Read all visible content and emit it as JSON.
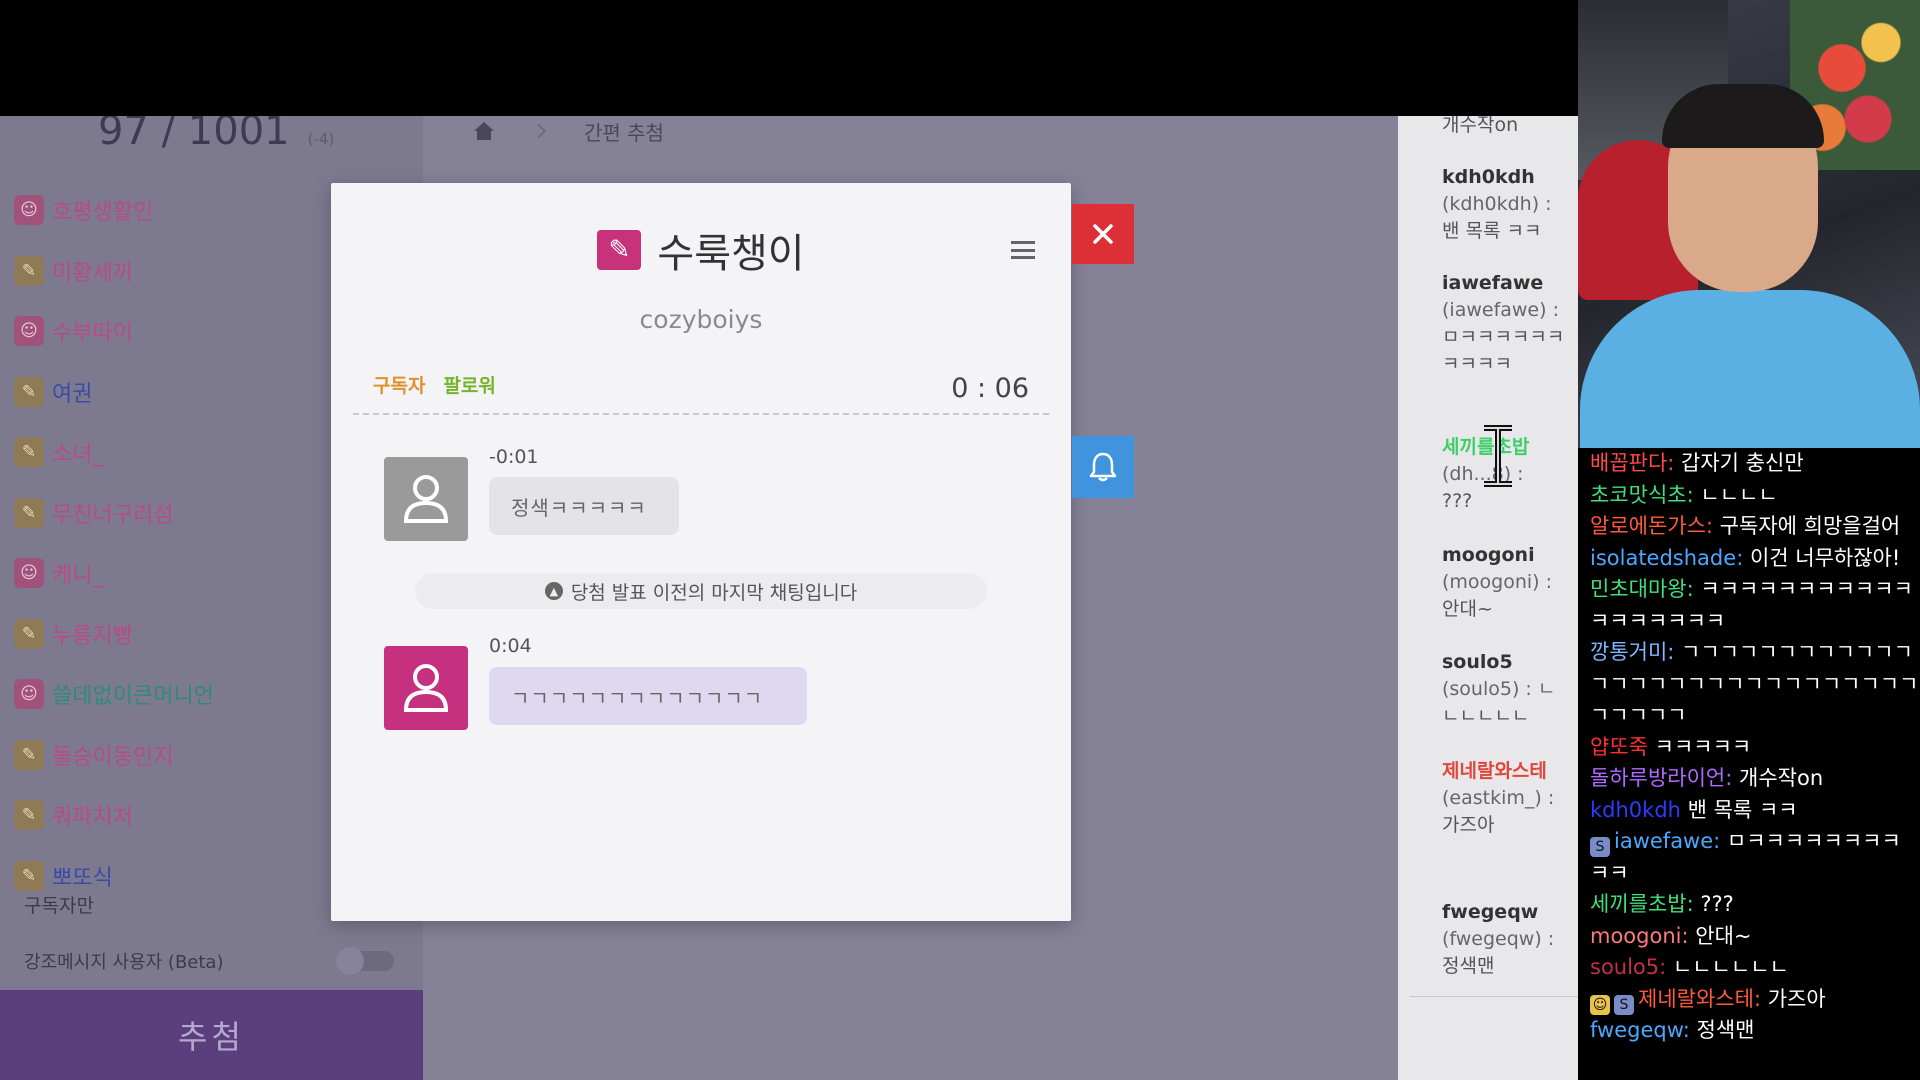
{
  "counter": {
    "count": "97 / 1001",
    "delta": "(-4)"
  },
  "winners": [
    {
      "name": "호평생활인",
      "icon": "subscriber-icon",
      "color": "#b84a8a"
    },
    {
      "name": "미황세끼",
      "icon": "fan-icon",
      "color": "#b84a8a"
    },
    {
      "name": "수부따이",
      "icon": "subscriber-icon",
      "color": "#b84a8a"
    },
    {
      "name": "여권",
      "icon": "fan-icon",
      "color": "#3a4aa8"
    },
    {
      "name": "소녀_",
      "icon": "fan-icon",
      "color": "#b84a8a"
    },
    {
      "name": "무친너구리섬",
      "icon": "fan-icon",
      "color": "#b84a8a"
    },
    {
      "name": "케니_",
      "icon": "subscriber-icon",
      "color": "#b84a8a"
    },
    {
      "name": "누룽지빵",
      "icon": "fan-icon",
      "color": "#b84a8a"
    },
    {
      "name": "쓸데없이큰머니언",
      "icon": "subscriber-icon",
      "color": "#2f8a7a"
    },
    {
      "name": "돌숭이동인지",
      "icon": "fan-icon",
      "color": "#b84a8a"
    },
    {
      "name": "쿼파치처",
      "icon": "fan-icon",
      "color": "#b84a8a"
    },
    {
      "name": "뽀또식",
      "icon": "fan-icon",
      "color": "#3a4aa8"
    }
  ],
  "sidebar": {
    "sub_only_label": "구독자만",
    "highlight_label": "강조메시지 사용자 (Beta)",
    "draw_button": "추첨"
  },
  "breadcrumb": {
    "current": "간편 추첨"
  },
  "modal": {
    "winner_name": "수룩챙이",
    "winner_id": "cozyboiys",
    "badge_subscriber": "구독자",
    "badge_follower": "팔로워",
    "timer": "0 : 06",
    "chat1": {
      "time": "-0:01",
      "message": "정색ㅋㅋㅋㅋㅋ"
    },
    "last_chat_note": "당첨 발표 이전의 마지막 채팅입니다",
    "chat2": {
      "time": "0:04",
      "message": "ㄱㄱㄱㄱㄱㄱㄱㄱㄱㄱㄱㄱㄱ"
    }
  },
  "chat_log": [
    {
      "name": "",
      "id": "",
      "message": "개수작on",
      "name_color": "#333"
    },
    {
      "name": "kdh0kdh",
      "id": "(kdh0kdh) :",
      "message": "밴 목록 ㅋㅋ",
      "name_color": "#333"
    },
    {
      "name": "iawefawe",
      "id": "(iawefawe) :",
      "message": "ㅁㅋㅋㅋㅋㅋㅋㅋㅋㅋㅋ",
      "name_color": "#333"
    },
    {
      "name": "세끼를초밥",
      "id": "(dh...8) :",
      "message": "???",
      "name_color": "#3fcf6a"
    },
    {
      "name": "moogoni",
      "id": "(moogoni) :",
      "message": "안대~",
      "name_color": "#333"
    },
    {
      "name": "soulo5",
      "id": "(soulo5) : ㄴ",
      "message": "ㄴㄴㄴㄴㄴ",
      "name_color": "#333"
    },
    {
      "name": "제네랄와스테",
      "id": "(eastkim_) :",
      "message": "가즈아",
      "name_color": "#e0463a"
    },
    {
      "name": "fwegeqw",
      "id": "(fwegeqw) :",
      "message": "정색맨",
      "name_color": "#333"
    }
  ],
  "stream_chat": [
    {
      "name": "배꼽판다",
      "sep": ": ",
      "message": "갑자기 충신만",
      "color": "#ff4a4a",
      "badges": []
    },
    {
      "name": "초코맛식초",
      "sep": ": ",
      "message": "ㄴㄴㄴㄴ",
      "color": "#3fe07a",
      "badges": []
    },
    {
      "name": "알로에돈가스",
      "sep": ": ",
      "message": "구독자에 희망을걸어",
      "color": "#ff5a3c",
      "badges": []
    },
    {
      "name": "isolatedshade",
      "sep": ": ",
      "message": "이건 너무하잖아!",
      "color": "#4aa8ff",
      "badges": []
    },
    {
      "name": "민초대마왕",
      "sep": ": ",
      "message": "ㅋㅋㅋㅋㅋㅋㅋㅋㅋㅋㅋㅋㅋㅋㅋㅋㅋㅋ",
      "color": "#3fe07a",
      "badges": []
    },
    {
      "name": "깡통거미",
      "sep": ": ",
      "message": "ㄱㄱㄱㄱㄱㄱㄱㄱㄱㄱㄱㄱㄱㄱㄱㄱㄱㄱㄱㄱㄱㄱㄱㄱㄱㄱㄱㄱㄱㄱㄱㄱㄱㄱ",
      "color": "#7fb8ff",
      "badges": []
    },
    {
      "name": "얍또죽",
      "sep": " ",
      "message": "ㅋㅋㅋㅋㅋ",
      "color": "#ff3030",
      "badges": []
    },
    {
      "name": "돌하루방라이언",
      "sep": ": ",
      "message": "개수작on",
      "color": "#b06aff",
      "badges": []
    },
    {
      "name": "kdh0kdh",
      "sep": " ",
      "message": "밴 목록 ㅋㅋ",
      "color": "#2a3dff",
      "badges": []
    },
    {
      "name": "iawefawe",
      "sep": ": ",
      "message": "ㅁㅋㅋㅋㅋㅋㅋㅋㅋㅋㅋ",
      "color": "#4aa8ff",
      "badges": [
        "S"
      ]
    },
    {
      "name": "세끼를초밥",
      "sep": ": ",
      "message": "???",
      "color": "#3fe07a",
      "badges": []
    },
    {
      "name": "moogoni",
      "sep": ": ",
      "message": "안대~",
      "color": "#ff7a7a",
      "badges": []
    },
    {
      "name": "soulo5",
      "sep": ": ",
      "message": "ㄴㄴㄴㄴㄴㄴ",
      "color": "#c0304a",
      "badges": []
    },
    {
      "name": "제네랄와스테",
      "sep": ": ",
      "message": "가즈아",
      "color": "#ff5a3c",
      "badges": [
        "fan",
        "S"
      ]
    },
    {
      "name": "fwegeqw",
      "sep": ": ",
      "message": "정색맨",
      "color": "#4aa8ff",
      "badges": []
    }
  ]
}
